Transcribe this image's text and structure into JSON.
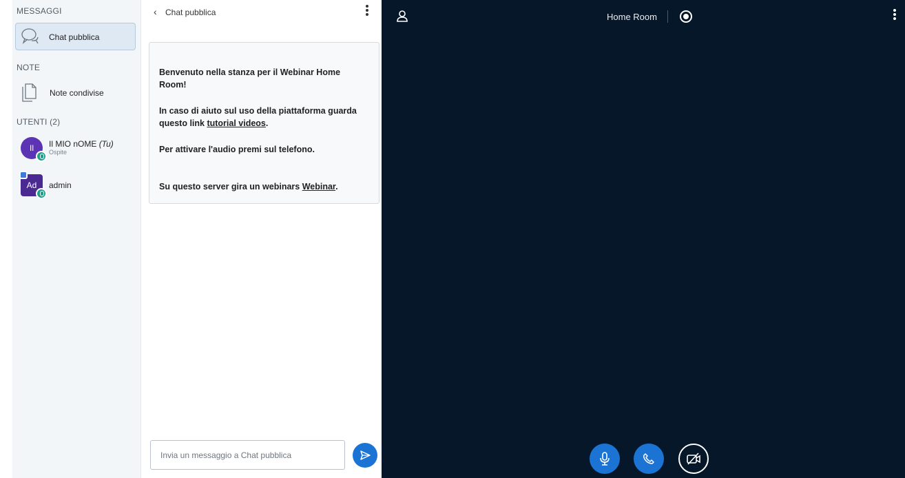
{
  "sidebar": {
    "messages_title": "MESSAGGI",
    "public_chat_label": "Chat pubblica",
    "notes_title": "NOTE",
    "shared_notes_label": "Note condivise",
    "users_title": "UTENTI (2)",
    "users": [
      {
        "initials": "Il",
        "name": "Il MIO nOME",
        "you_tag": "(Tu)",
        "role": "Ospite"
      },
      {
        "initials": "Ad",
        "name": "admin"
      }
    ]
  },
  "chat": {
    "back_icon": "chevron-left-icon",
    "title": "Chat pubblica",
    "welcome": {
      "line1_a": "Benvenuto nella stanza per il Webinar ",
      "line1_b": "Home Room!",
      "line2_a": "In caso di aiuto sul uso della piattaforma guarda questo link ",
      "line2_link": "tutorial videos",
      "line2_c": ".",
      "line3": "Per attivare l'audio premi sul telefono.",
      "line4_a": "Su questo server gira un webinars ",
      "line4_link": "Webinar",
      "line4_c": "."
    },
    "input_placeholder": "Invia un messaggio a Chat pubblica"
  },
  "main": {
    "room_title": "Home Room",
    "controls": [
      "microphone-icon",
      "phone-icon",
      "camera-off-icon"
    ]
  },
  "colors": {
    "accent": "#1b74d3",
    "main_bg": "#06172a",
    "sidebar_bg": "#f3f6f9",
    "avatar_guest": "#5b33b4",
    "avatar_admin": "#4a2a92",
    "status_badge": "#1e9e8b"
  }
}
